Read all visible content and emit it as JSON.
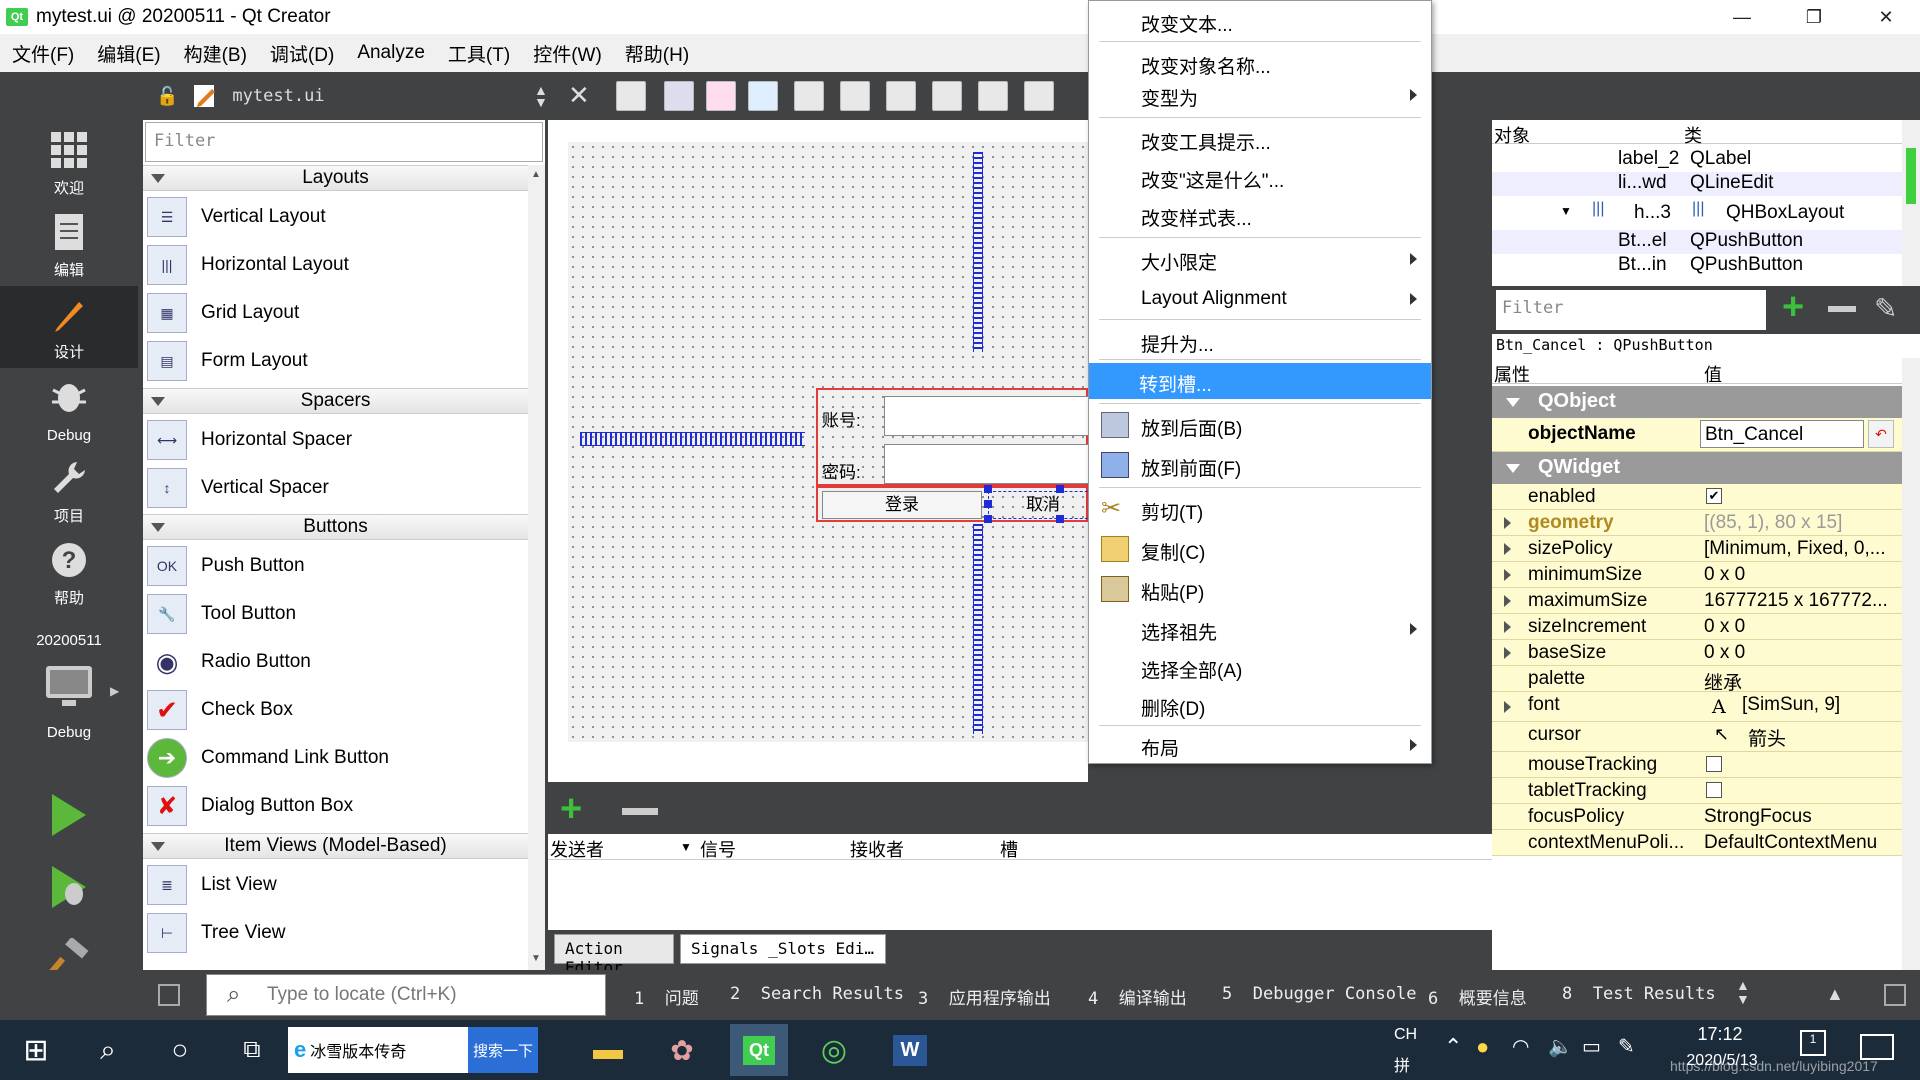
{
  "window": {
    "title": "mytest.ui @ 20200511 - Qt Creator",
    "app_icon": "Qt",
    "buttons": [
      "minimize",
      "maximize",
      "close"
    ]
  },
  "menubar": [
    "文件(F)",
    "编辑(E)",
    "构建(B)",
    "调试(D)",
    "Analyze",
    "工具(T)",
    "控件(W)",
    "帮助(H)"
  ],
  "modes": [
    {
      "label": "欢迎",
      "icon": "grid-icon"
    },
    {
      "label": "编辑",
      "icon": "document-icon"
    },
    {
      "label": "设计",
      "icon": "pencil-icon"
    },
    {
      "label": "Debug",
      "icon": "bug-icon"
    },
    {
      "label": "项目",
      "icon": "wrench-icon"
    },
    {
      "label": "帮助",
      "icon": "help-icon"
    }
  ],
  "kit": {
    "name": "20200511",
    "mode": "Debug"
  },
  "editor": {
    "filename": "mytest.ui"
  },
  "widgetbox": {
    "filter_placeholder": "Filter",
    "categories": {
      "layouts": "Layouts",
      "spacers": "Spacers",
      "buttons": "Buttons",
      "itemviews": "Item Views (Model-Based)"
    },
    "layouts": [
      "Vertical Layout",
      "Horizontal Layout",
      "Grid Layout",
      "Form Layout"
    ],
    "spacers": [
      "Horizontal Spacer",
      "Vertical Spacer"
    ],
    "buttons": [
      "Push Button",
      "Tool Button",
      "Radio Button",
      "Check Box",
      "Command Link Button",
      "Dialog Button Box"
    ],
    "itemviews": [
      "List View",
      "Tree View"
    ],
    "icon_text": {
      "push": "OK"
    }
  },
  "form": {
    "account_label": "账号:",
    "password_label": "密码:",
    "login_button": "登录",
    "cancel_button": "取消"
  },
  "context_menu": {
    "items": [
      "改变文本...",
      "改变对象名称...",
      "变型为",
      "改变工具提示...",
      "改变\"这是什么\"...",
      "改变样式表...",
      "大小限定",
      "Layout Alignment",
      "提升为...",
      "转到槽...",
      "放到后面(B)",
      "放到前面(F)",
      "剪切(T)",
      "复制(C)",
      "粘贴(P)",
      "选择祖先",
      "选择全部(A)",
      "删除(D)",
      "布局"
    ],
    "highlighted": "转到槽..."
  },
  "signals": {
    "columns": [
      "发送者",
      "信号",
      "接收者",
      "槽"
    ],
    "tabs": [
      "Action Editor",
      "Signals _Slots Edi…"
    ]
  },
  "objects": {
    "header": [
      "对象",
      "类"
    ],
    "rows": [
      {
        "name": "label_2",
        "class": "QLabel"
      },
      {
        "name": "li...wd",
        "class": "QLineEdit"
      },
      {
        "name": "h...3",
        "class": "QHBoxLayout"
      },
      {
        "name": "Bt...el",
        "class": "QPushButton"
      },
      {
        "name": "Bt...in",
        "class": "QPushButton"
      }
    ]
  },
  "properties": {
    "filter_placeholder": "Filter",
    "selected": "Btn_Cancel : QPushButton",
    "header": [
      "属性",
      "值"
    ],
    "groups": {
      "qobject": "QObject",
      "qwidget": "QWidget"
    },
    "objectName": {
      "name": "objectName",
      "value": "Btn_Cancel"
    },
    "rows": [
      {
        "name": "enabled",
        "value": "",
        "checked": true
      },
      {
        "name": "geometry",
        "value": "[(85, 1), 80 x 15]"
      },
      {
        "name": "sizePolicy",
        "value": "[Minimum, Fixed, 0,..."
      },
      {
        "name": "minimumSize",
        "value": "0 x 0"
      },
      {
        "name": "maximumSize",
        "value": "16777215 x 167772..."
      },
      {
        "name": "sizeIncrement",
        "value": "0 x 0"
      },
      {
        "name": "baseSize",
        "value": "0 x 0"
      },
      {
        "name": "palette",
        "value": "继承"
      },
      {
        "name": "font",
        "value": "[SimSun, 9]",
        "glyph": "A"
      },
      {
        "name": "cursor",
        "value": "箭头"
      },
      {
        "name": "mouseTracking",
        "value": "",
        "checked": false
      },
      {
        "name": "tabletTracking",
        "value": "",
        "checked": false
      },
      {
        "name": "focusPolicy",
        "value": "StrongFocus"
      },
      {
        "name": "contextMenuPoli...",
        "value": "DefaultContextMenu"
      }
    ]
  },
  "statusbar": {
    "locate_placeholder": "Type to locate (Ctrl+K)",
    "tabs": [
      {
        "num": "1",
        "label": "问题"
      },
      {
        "num": "2",
        "label": "Search Results"
      },
      {
        "num": "3",
        "label": "应用程序输出"
      },
      {
        "num": "4",
        "label": "编译输出"
      },
      {
        "num": "5",
        "label": "Debugger Console"
      },
      {
        "num": "6",
        "label": "概要信息"
      },
      {
        "num": "8",
        "label": "Test Results"
      }
    ]
  },
  "taskbar": {
    "search_text": "冰雪版本传奇",
    "search_button": "搜索一下",
    "ime": "CH",
    "ime2": "拼",
    "time": "17:12",
    "date": "2020/5/13",
    "notif": "1",
    "watermark": "https://blog.csdn.net/luyibing2017"
  },
  "colors": {
    "accent": "#3399ff",
    "dark": "#404244",
    "prop_yellow": "#fffbd0",
    "group_gray": "#9a9a9a",
    "spacer": "#1e2bd6",
    "layout_red": "#e23b3b"
  }
}
